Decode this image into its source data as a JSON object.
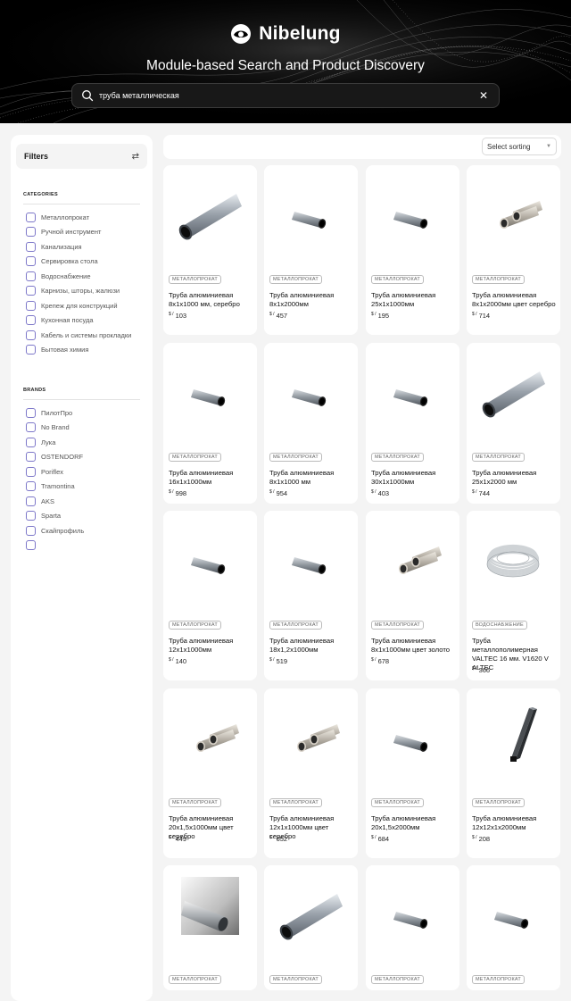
{
  "brand": {
    "name": "Nibelung"
  },
  "hero": {
    "title": "Module-based Search and Product Discovery"
  },
  "search": {
    "value": "труба металлическая",
    "clear_icon": "close-icon"
  },
  "filters": {
    "title": "Filters",
    "categories_title": "CATEGORIES",
    "categories": [
      "Металлопрокат",
      "Ручной инструмент",
      "Канализация",
      "Сервировка стола",
      "Водоснабжение",
      "Карнизы, шторы, жалюзи",
      "Крепеж для конструкций",
      "Кухонная посуда",
      "Кабель и системы прокладки",
      "Бытовая химия"
    ],
    "brands_title": "BRANDS",
    "brands": [
      "ПилотПро",
      "No Brand",
      "Лука",
      "OSTENDORF",
      "Poriflex",
      "Tramontina",
      "AKS",
      "Sparta",
      "Скайпрофиль",
      ""
    ]
  },
  "sort": {
    "label": "Select sorting"
  },
  "currency": "$ /",
  "colors": {
    "accent_checkbox": "#7d77c9",
    "hero_bg": "#000000",
    "page_bg": "#f4f4f4"
  },
  "products": [
    {
      "badge": "МЕТАЛЛОПРОКАТ",
      "name": "Труба алюминиевая 8x1x1000 мм, серебро",
      "price": "103",
      "img": "pipe-long"
    },
    {
      "badge": "МЕТАЛЛОПРОКАТ",
      "name": "Труба алюминиевая 8x1x2000мм",
      "price": "457",
      "img": "pipe-short"
    },
    {
      "badge": "МЕТАЛЛОПРОКАТ",
      "name": "Труба алюминиевая 25x1x1000мм",
      "price": "195",
      "img": "pipe-short"
    },
    {
      "badge": "МЕТАЛЛОПРОКАТ",
      "name": "Труба алюминиевая 8x1x2000мм цвет серебро",
      "price": "714",
      "img": "pipe-pair"
    },
    {
      "badge": "МЕТАЛЛОПРОКАТ",
      "name": "Труба алюминиевая 16x1x1000мм",
      "price": "998",
      "img": "pipe-short"
    },
    {
      "badge": "МЕТАЛЛОПРОКАТ",
      "name": "Труба алюминиевая 8x1x1000 мм",
      "price": "954",
      "img": "pipe-short"
    },
    {
      "badge": "МЕТАЛЛОПРОКАТ",
      "name": "Труба алюминиевая 30x1x1000мм",
      "price": "403",
      "img": "pipe-short"
    },
    {
      "badge": "МЕТАЛЛОПРОКАТ",
      "name": "Труба алюминиевая 25x1x2000 мм",
      "price": "744",
      "img": "pipe-long"
    },
    {
      "badge": "МЕТАЛЛОПРОКАТ",
      "name": "Труба алюминиевая 12x1x1000мм",
      "price": "140",
      "img": "pipe-short"
    },
    {
      "badge": "МЕТАЛЛОПРОКАТ",
      "name": "Труба алюминиевая 18x1,2x1000мм",
      "price": "519",
      "img": "pipe-short"
    },
    {
      "badge": "МЕТАЛЛОПРОКАТ",
      "name": "Труба алюминиевая 8x1x1000мм цвет золото",
      "price": "678",
      "img": "pipe-pair"
    },
    {
      "badge": "ВОДОСНАБЖЕНИЕ",
      "name": "Труба металлополимерная VALTEC 16 мм. V1620 V ALTEC",
      "price": "366",
      "img": "coil"
    },
    {
      "badge": "МЕТАЛЛОПРОКАТ",
      "name": "Труба алюминиевая 20x1,5x1000мм цвет серебро",
      "price": "449",
      "img": "pipe-pair"
    },
    {
      "badge": "МЕТАЛЛОПРОКАТ",
      "name": "Труба алюминиевая 12x1x1000мм цвет серебро",
      "price": "652",
      "img": "pipe-pair"
    },
    {
      "badge": "МЕТАЛЛОПРОКАТ",
      "name": "Труба алюминиевая 20x1,5x2000мм",
      "price": "684",
      "img": "pipe-short"
    },
    {
      "badge": "МЕТАЛЛОПРОКАТ",
      "name": "Труба алюминиевая 12x12x1x2000мм",
      "price": "208",
      "img": "square"
    },
    {
      "badge": "МЕТАЛЛОПРОКАТ",
      "name": "",
      "price": "",
      "img": "photo"
    },
    {
      "badge": "МЕТАЛЛОПРОКАТ",
      "name": "",
      "price": "",
      "img": "pipe-long"
    },
    {
      "badge": "МЕТАЛЛОПРОКАТ",
      "name": "",
      "price": "",
      "img": "pipe-short"
    },
    {
      "badge": "МЕТАЛЛОПРОКАТ",
      "name": "",
      "price": "",
      "img": "pipe-short"
    }
  ]
}
